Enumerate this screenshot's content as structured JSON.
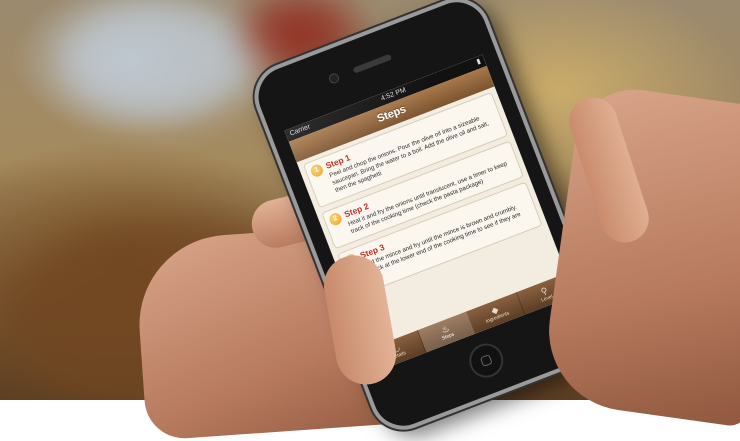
{
  "statusbar": {
    "carrier": "Carrier",
    "time": "4:52 PM"
  },
  "navbar": {
    "title": "Steps"
  },
  "steps": [
    {
      "number": "1",
      "title": "Step 1",
      "text": "Peel and chop the onions. Pour the olive oil into a sizeable saucepan. Bring the water to a boil. Add the olive oil and salt, then the spaghetti"
    },
    {
      "number": "2",
      "title": "Step 2",
      "text": "Heat it and fry the onions until translucent, use a timer to keep track of the cooking time (check the pasta package)"
    },
    {
      "number": "3",
      "title": "Step 3",
      "text": "Add the mince and fry until the mince is brown and crumbly. Check at the lower end of the cooking time to see if they are done"
    }
  ],
  "tabbar": {
    "tabs": [
      {
        "label": "Details",
        "icon": "bowl-icon"
      },
      {
        "label": "Steps",
        "icon": "pot-icon"
      },
      {
        "label": "Ingredients",
        "icon": "pin-icon"
      },
      {
        "label": "Level",
        "icon": "location-icon"
      }
    ],
    "active_index": 1
  },
  "colors": {
    "accent": "#c0241b",
    "nav_brown": "#7b5430",
    "badge_orange": "#e79a19"
  }
}
